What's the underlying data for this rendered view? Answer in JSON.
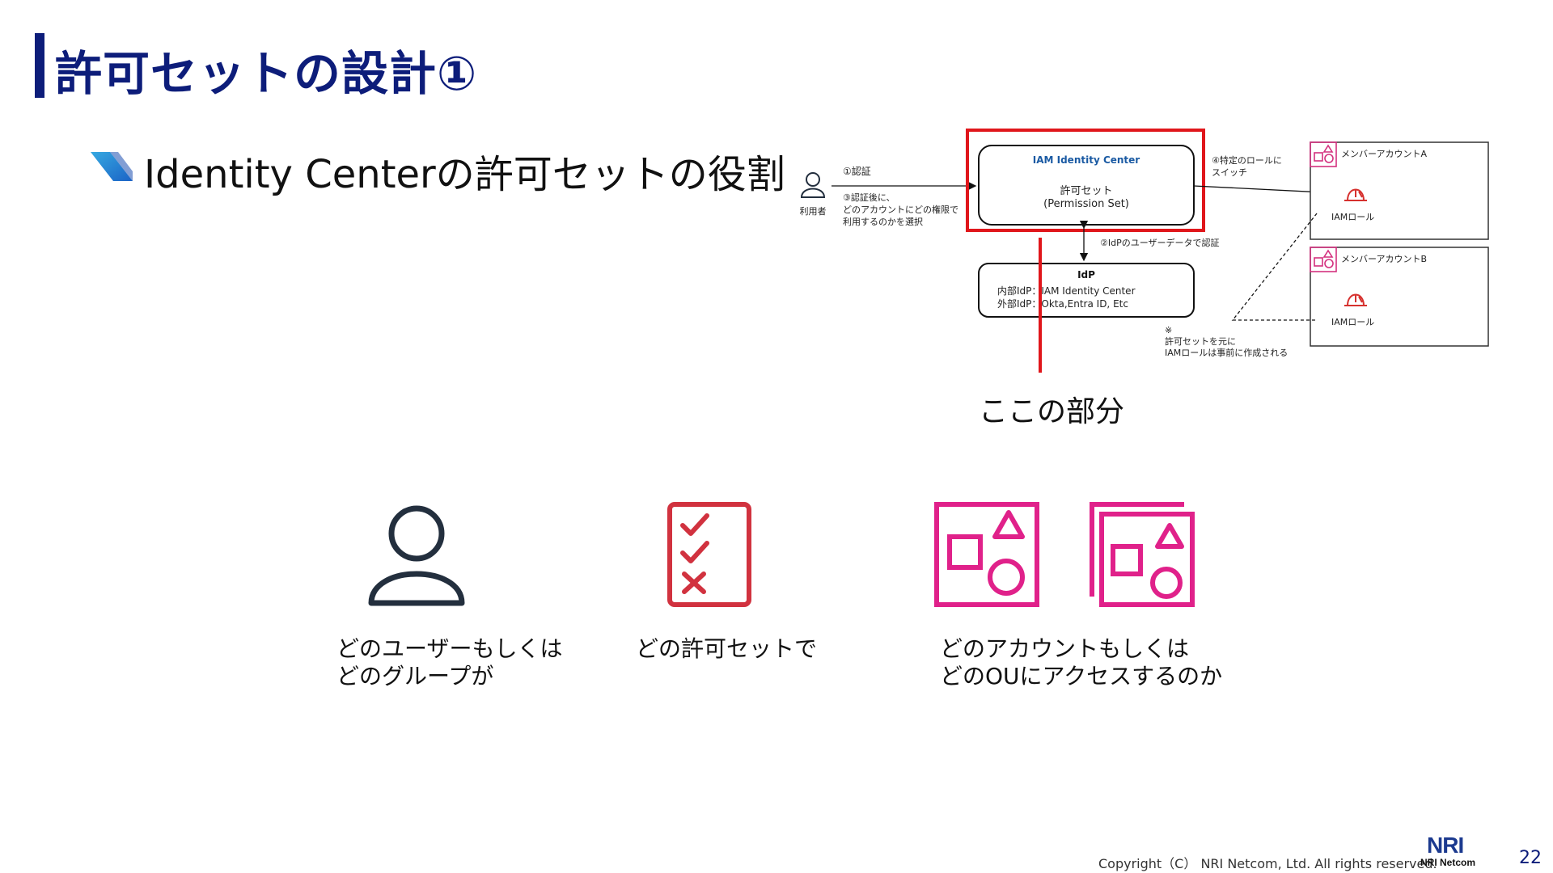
{
  "header": {
    "title": "許可セットの設計①",
    "subtitle": "Identity Centerの許可セットの役割"
  },
  "diagram": {
    "user_label": "利用者",
    "step1": "①認証",
    "step3_line1": "③認証後に、",
    "step3_line2": "どのアカウントにどの権限で",
    "step3_line3": "利用するのかを選択",
    "iam_center_title": "IAM Identity Center",
    "permission_set_line1": "許可セット",
    "permission_set_line2": "(Permission Set)",
    "step4_line1": "④特定のロールに",
    "step4_line2": "スイッチ",
    "step2": "②IdPのユーザーデータで認証",
    "idp_title": "IdP",
    "idp_line1": "内部IdP：IAM Identity Center",
    "idp_line2": "外部IdP：Okta,Entra ID, Etc",
    "account_a": "メンバーアカウントA",
    "account_b": "メンバーアカウントB",
    "iam_role_a": "IAMロール",
    "iam_role_b": "IAMロール",
    "note_mark": "※",
    "note_line1": "許可セットを元に",
    "note_line2": "IAMロールは事前に作成される",
    "colors": {
      "highlight_red": "#e0161b",
      "role_red": "#d6312e",
      "account_pink": "#d4317f",
      "center_blue": "#1a5aa3"
    }
  },
  "callout": {
    "caption": "ここの部分"
  },
  "icons": {
    "user_icon": "user-icon",
    "checklist_icon": "checklist-icon",
    "account_icon": "account-icon",
    "ou_icon": "organizational-unit-icon",
    "user_caption_line1": "どのユーザーもしくは",
    "user_caption_line2": "どのグループが",
    "permset_caption": "どの許可セットで",
    "account_caption_line1": "どのアカウントもしくは",
    "account_caption_line2": "どのOUにアクセスするのか",
    "colors": {
      "user": "#232f3e",
      "checklist": "#d1323f",
      "account": "#e0218a"
    }
  },
  "footer": {
    "copyright": "Copyright（C） NRI Netcom, Ltd. All rights reserved.",
    "logo_big": "NRI",
    "logo_small": "NRI Netcom",
    "page_number": "22"
  },
  "theme": {
    "title_color": "#0d1d7a"
  }
}
